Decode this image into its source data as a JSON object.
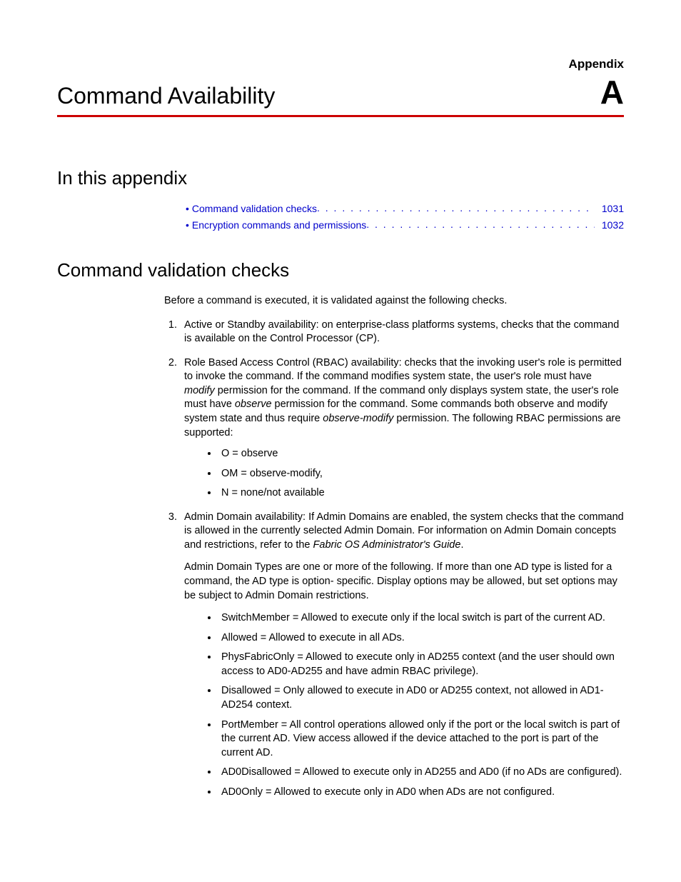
{
  "header": {
    "label": "Appendix",
    "title": "Command Availability",
    "letter": "A"
  },
  "sections": {
    "toc_heading": "In this appendix",
    "toc": [
      {
        "label": "Command validation checks",
        "page": "1031"
      },
      {
        "label": "Encryption commands and permissions",
        "page": "1032"
      }
    ],
    "cvc_heading": "Command validation checks",
    "cvc_intro": "Before a command is executed, it is validated against the following checks.",
    "item1": "Active or Standby availability: on enterprise-class platforms systems, checks that the command is available on the Control Processor (CP).",
    "item2_pre": "Role Based Access Control (RBAC) availability: checks that the invoking user's role is permitted to invoke the command. If the command modifies system state, the user's role must have ",
    "item2_em1": "modify",
    "item2_mid1": " permission for the command. If the command only displays system state, the user's role must have ",
    "item2_em2": "observe",
    "item2_mid2": " permission for the command. Some commands both observe and modify system state and thus require ",
    "item2_em3": "observe-modify",
    "item2_post": " permission. The following RBAC permissions are supported:",
    "item2_bullets": [
      "O = observe",
      "OM = observe-modify,",
      "N = none/not available"
    ],
    "item3_p1_pre": "Admin Domain availability: If Admin Domains are enabled, the system checks that the command is allowed in the currently selected Admin Domain. For information on Admin Domain concepts and restrictions, refer to the ",
    "item3_p1_em": "Fabric OS Administrator's Guide",
    "item3_p1_post": ".",
    "item3_p2": "Admin Domain Types are one or more of the following. If more than one AD type is listed for a command, the AD type is option- specific. Display options may be allowed, but set options may be subject to Admin Domain restrictions.",
    "item3_bullets": [
      "SwitchMember = Allowed to execute only if the local switch is part of the current AD.",
      "Allowed = Allowed to execute in all ADs.",
      "PhysFabricOnly = Allowed to execute only in AD255 context (and the user should own access to AD0-AD255 and have admin RBAC privilege).",
      "Disallowed = Only allowed to execute in AD0 or AD255 context, not allowed in AD1-AD254 context.",
      "PortMember = All control operations allowed only if the port or the local switch is part of the current AD. View access allowed if the device attached to the port is part of the current AD.",
      "AD0Disallowed = Allowed to execute only in AD255 and AD0 (if no ADs are configured).",
      "AD0Only = Allowed to execute only in AD0 when ADs are not configured."
    ]
  }
}
